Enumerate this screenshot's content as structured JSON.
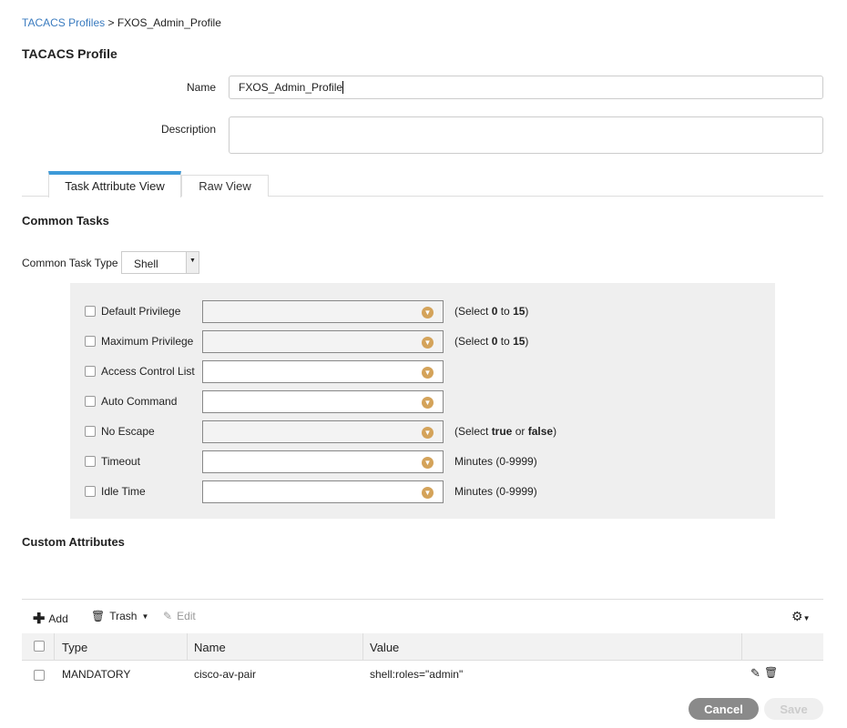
{
  "breadcrumb": {
    "parent": "TACACS Profiles",
    "separator": ">",
    "current": "FXOS_Admin_Profile"
  },
  "section_title": "TACACS Profile",
  "form": {
    "name_label": "Name",
    "name_value": "FXOS_Admin_Profile",
    "description_label": "Description",
    "description_value": ""
  },
  "tabs": [
    {
      "label": "Task Attribute View",
      "active": true
    },
    {
      "label": "Raw View",
      "active": false
    }
  ],
  "common_tasks": {
    "title": "Common Tasks",
    "type_label": "Common Task Type",
    "type_value": "Shell",
    "rows": [
      {
        "label": "Default Privilege",
        "disabled": true,
        "hint_pre": "(Select ",
        "hint_b1": "0",
        "hint_mid": " to ",
        "hint_b2": "15",
        "hint_post": ")"
      },
      {
        "label": "Maximum Privilege",
        "disabled": true,
        "hint_pre": "(Select ",
        "hint_b1": "0",
        "hint_mid": " to ",
        "hint_b2": "15",
        "hint_post": ")"
      },
      {
        "label": "Access Control List",
        "disabled": false
      },
      {
        "label": "Auto Command",
        "disabled": false
      },
      {
        "label": "No Escape",
        "disabled": true,
        "hint_pre": "(Select ",
        "hint_b1": "true",
        "hint_mid": " or ",
        "hint_b2": "false",
        "hint_post": ")"
      },
      {
        "label": "Timeout",
        "disabled": false,
        "hint_pre": "Minutes (0-9999)"
      },
      {
        "label": "Idle Time",
        "disabled": false,
        "hint_pre": "Minutes (0-9999)"
      }
    ]
  },
  "custom_attributes": {
    "title": "Custom Attributes",
    "toolbar": {
      "add": "Add",
      "trash": "Trash",
      "edit": "Edit"
    },
    "columns": [
      "Type",
      "Name",
      "Value"
    ],
    "rows": [
      {
        "type": "MANDATORY",
        "name": "cisco-av-pair",
        "value": "shell:roles=\"admin\""
      }
    ]
  },
  "buttons": {
    "cancel": "Cancel",
    "save": "Save"
  },
  "colors": {
    "link": "#3a7bbf",
    "tab_accent": "#3d9ad8",
    "dropdown_icon": "#d4a35a",
    "cancel_bg": "#8a8a8a"
  }
}
